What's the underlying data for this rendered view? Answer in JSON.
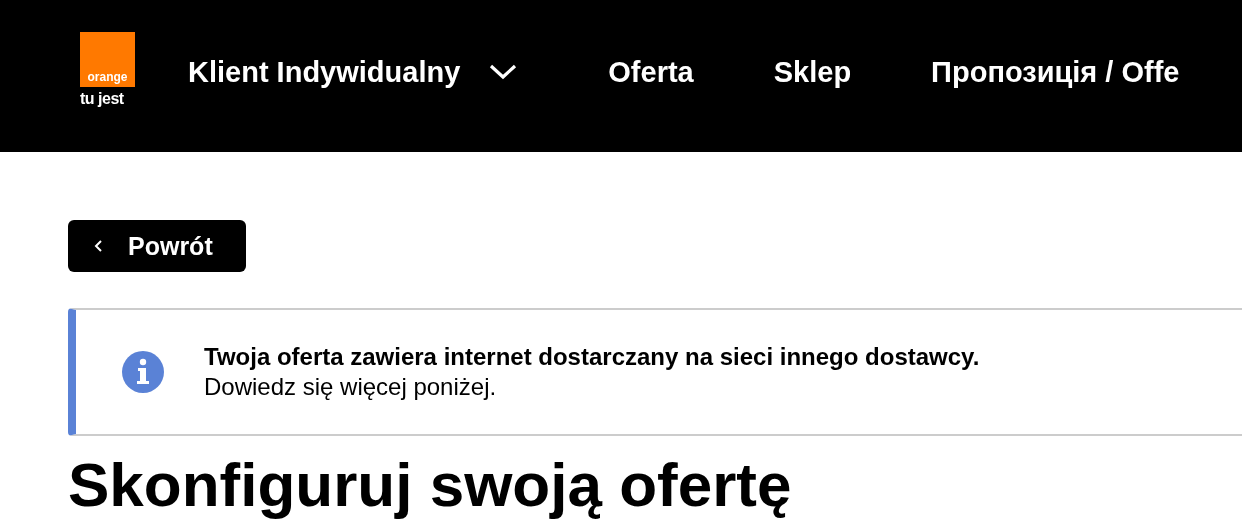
{
  "header": {
    "logo": {
      "brand": "orange",
      "tagline": "tu jest"
    },
    "nav": [
      {
        "label": "Klient Indywidualny",
        "kind": "dropdown"
      },
      {
        "label": "Oferta",
        "kind": "link"
      },
      {
        "label": "Sklep",
        "kind": "link"
      },
      {
        "label": "Пропозиція / Offe",
        "kind": "link"
      }
    ]
  },
  "back_button": {
    "label": "Powrót"
  },
  "notice": {
    "title": "Twoja oferta zawiera internet dostarczany na sieci innego dostawcy.",
    "text": "Dowiedz się więcej poniżej."
  },
  "heading": "Skonfiguruj swoją ofertę"
}
